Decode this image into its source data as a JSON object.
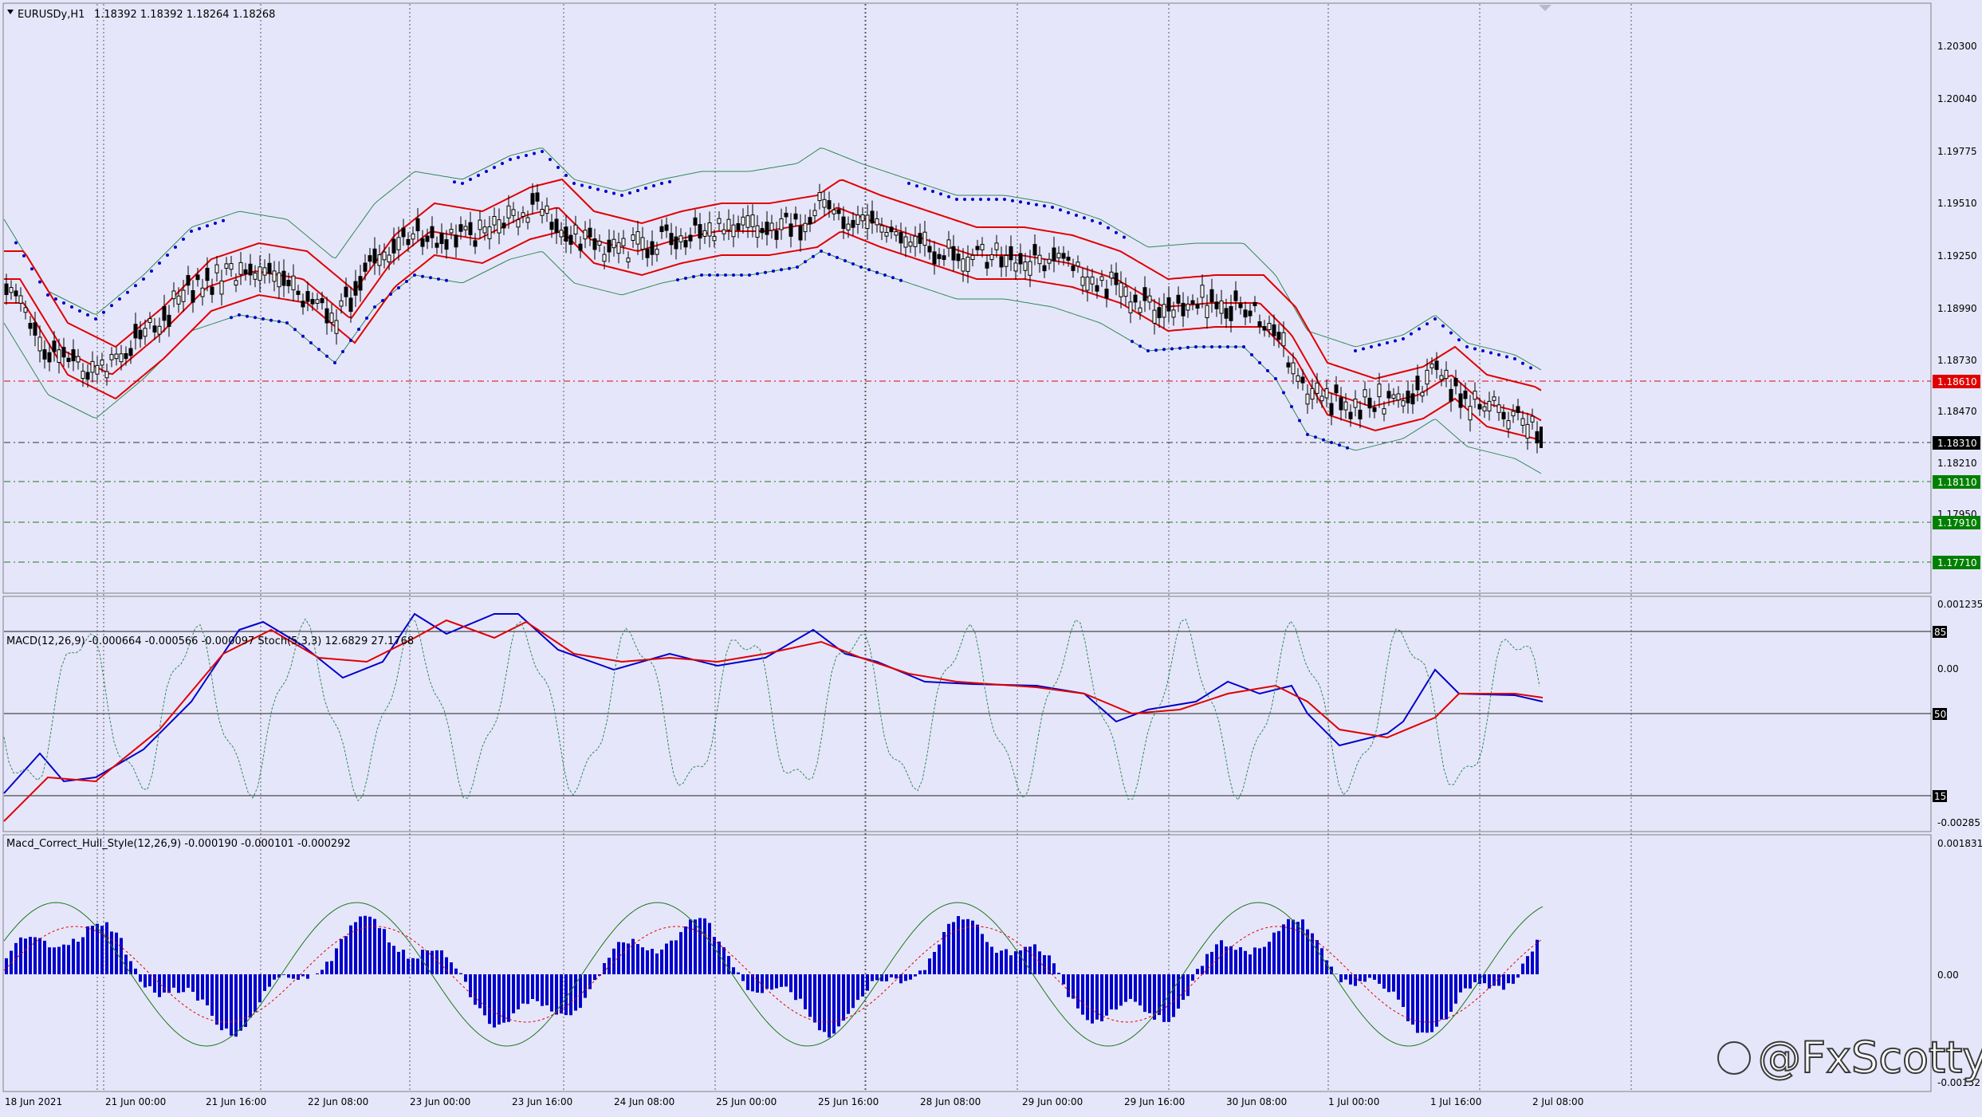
{
  "window": {
    "title": "EURUSDy,H1",
    "ohlc": "1.18392 1.18392 1.18264 1.18268"
  },
  "indicators": {
    "macd_stoch_label": "MACD(12,26,9) -0.000664 -0.000566 -0.000097  Stoch(5,3,3) 12.6829 27.1768",
    "hull_label": "Macd_Correct_Hull_Style(12,26,9) -0.000190 -0.000101 -0.000292"
  },
  "price_axis": {
    "ticks": [
      "1.20300",
      "1.20040",
      "1.19775",
      "1.19510",
      "1.19250",
      "1.18990",
      "1.18730",
      "1.18470",
      "1.18210",
      "1.17950"
    ],
    "current_price": "1.18310",
    "red_level": "1.18610",
    "green_levels": [
      "1.18110",
      "1.17910",
      "1.17710"
    ]
  },
  "macd_axis": {
    "top": "0.001235",
    "levels": [
      "85",
      "0.00",
      "50",
      "15"
    ],
    "bottom": "-0.00285"
  },
  "hull_axis": {
    "top": "0.001831",
    "zero": "0.00",
    "bottom": "-0.00152"
  },
  "time_axis": [
    "18 Jun 2021",
    "21 Jun 00:00",
    "21 Jun 16:00",
    "22 Jun 08:00",
    "23 Jun 00:00",
    "23 Jun 16:00",
    "24 Jun 08:00",
    "25 Jun 00:00",
    "25 Jun 16:00",
    "28 Jun 08:00",
    "29 Jun 00:00",
    "29 Jun 16:00",
    "30 Jun 08:00",
    "1 Jul 00:00",
    "1 Jul 16:00",
    "2 Jul 08:00"
  ],
  "watermark": "@FxScotty",
  "colors": {
    "background": "#e6e6fa",
    "candle": "#000000",
    "bands_outer": "#2e8b57",
    "bands_inner": "#e00000",
    "sar": "#0000cc",
    "macd_main": "#0000cc",
    "macd_signal": "#e00000",
    "stoch": "#2e8b57",
    "histogram": "#0000cc",
    "red_tag": "#e00000",
    "green_tag": "#008000"
  }
}
